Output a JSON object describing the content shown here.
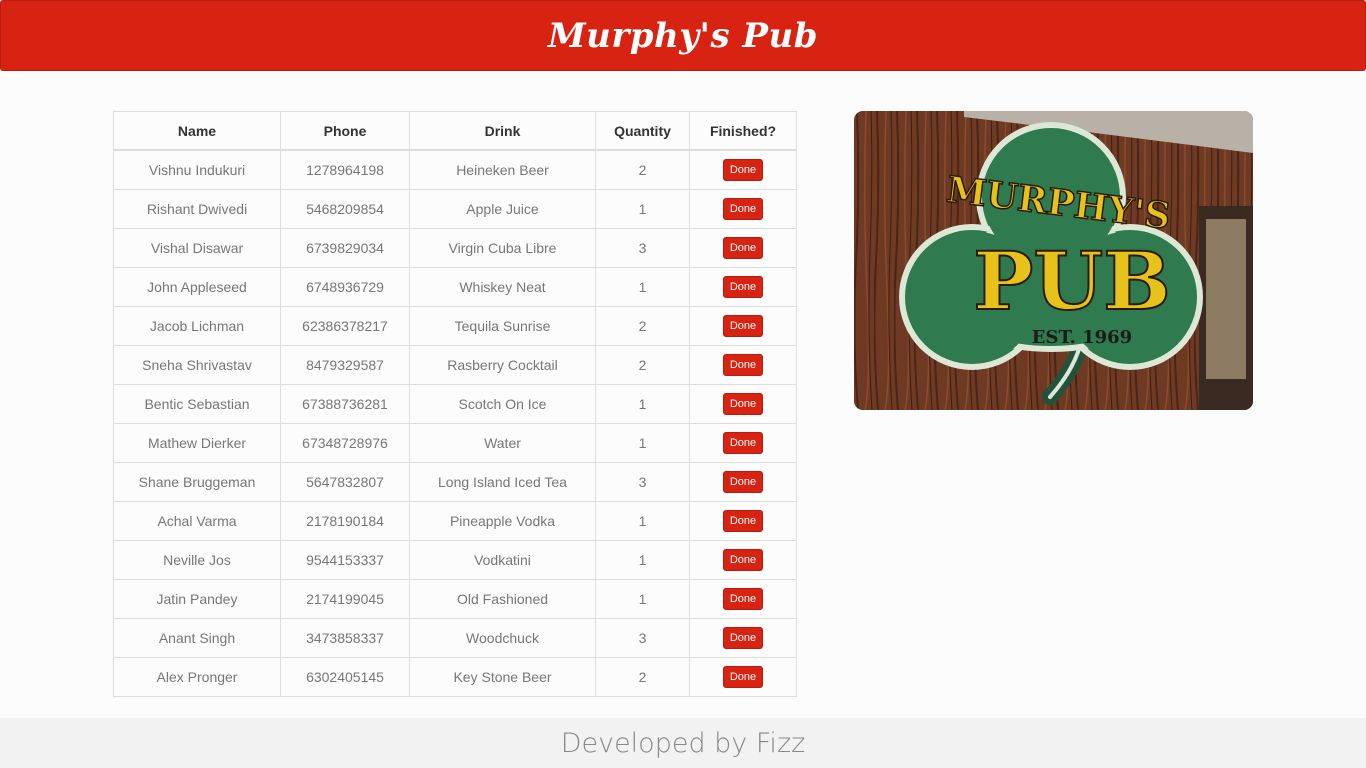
{
  "header": {
    "title": "Murphy's Pub"
  },
  "table": {
    "columns": [
      "Name",
      "Phone",
      "Drink",
      "Quantity",
      "Finished?"
    ],
    "rows": [
      {
        "name": "Vishnu Indukuri",
        "phone": "1278964198",
        "drink": "Heineken Beer",
        "quantity": "2",
        "action": "Done"
      },
      {
        "name": "Rishant Dwivedi",
        "phone": "5468209854",
        "drink": "Apple Juice",
        "quantity": "1",
        "action": "Done"
      },
      {
        "name": "Vishal Disawar",
        "phone": "6739829034",
        "drink": "Virgin Cuba Libre",
        "quantity": "3",
        "action": "Done"
      },
      {
        "name": "John Appleseed",
        "phone": "6748936729",
        "drink": "Whiskey Neat",
        "quantity": "1",
        "action": "Done"
      },
      {
        "name": "Jacob Lichman",
        "phone": "62386378217",
        "drink": "Tequila Sunrise",
        "quantity": "2",
        "action": "Done"
      },
      {
        "name": "Sneha Shrivastav",
        "phone": "8479329587",
        "drink": "Rasberry Cocktail",
        "quantity": "2",
        "action": "Done"
      },
      {
        "name": "Bentic Sebastian",
        "phone": "67388736281",
        "drink": "Scotch On Ice",
        "quantity": "1",
        "action": "Done"
      },
      {
        "name": "Mathew Dierker",
        "phone": "67348728976",
        "drink": "Water",
        "quantity": "1",
        "action": "Done"
      },
      {
        "name": "Shane Bruggeman",
        "phone": "5647832807",
        "drink": "Long Island Iced Tea",
        "quantity": "3",
        "action": "Done"
      },
      {
        "name": "Achal Varma",
        "phone": "2178190184",
        "drink": "Pineapple Vodka",
        "quantity": "1",
        "action": "Done"
      },
      {
        "name": "Neville Jos",
        "phone": "9544153337",
        "drink": "Vodkatini",
        "quantity": "1",
        "action": "Done"
      },
      {
        "name": "Jatin Pandey",
        "phone": "2174199045",
        "drink": "Old Fashioned",
        "quantity": "1",
        "action": "Done"
      },
      {
        "name": "Anant Singh",
        "phone": "3473858337",
        "drink": "Woodchuck",
        "quantity": "3",
        "action": "Done"
      },
      {
        "name": "Alex Pronger",
        "phone": "6302405145",
        "drink": "Key Stone Beer",
        "quantity": "2",
        "action": "Done"
      }
    ]
  },
  "image": {
    "sign_top": "MURPHY'S",
    "sign_main": "PUB",
    "sign_est": "EST. 1969"
  },
  "footer": {
    "text": "Developed by Fizz"
  },
  "colors": {
    "accent": "#d92312",
    "footer_bg": "#f2f2f2"
  }
}
